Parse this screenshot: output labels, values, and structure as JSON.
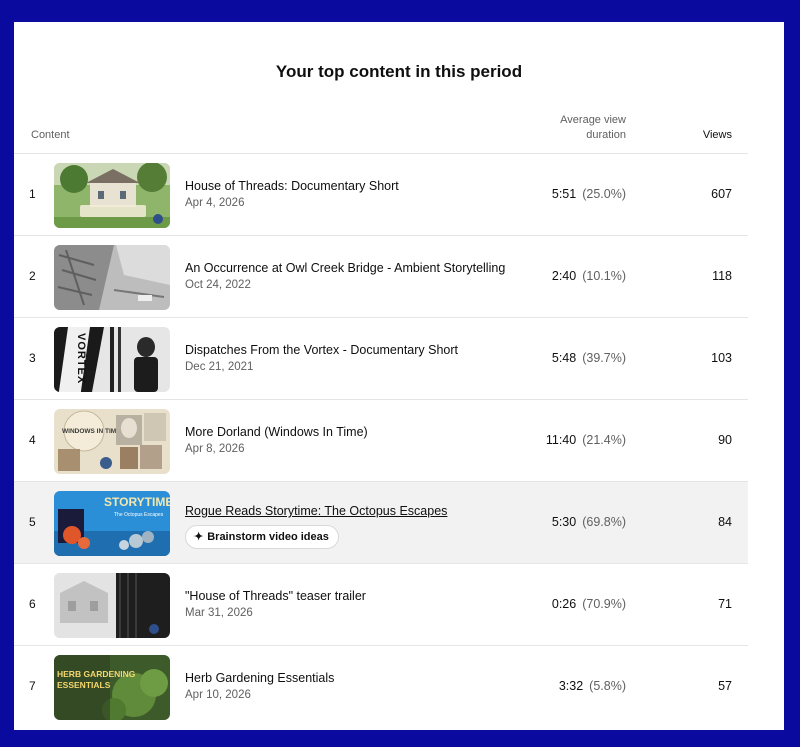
{
  "title": "Your top content in this period",
  "headers": {
    "content": "Content",
    "duration_line1": "Average view",
    "duration_line2": "duration",
    "views": "Views"
  },
  "rows": [
    {
      "rank": "1",
      "title": "House of Threads: Documentary Short",
      "date": "Apr 4, 2026",
      "duration": "5:51",
      "percent": "(25.0%)",
      "views": "607"
    },
    {
      "rank": "2",
      "title": "An Occurrence at Owl Creek Bridge - Ambient Storytelling",
      "date": "Oct 24, 2022",
      "duration": "2:40",
      "percent": "(10.1%)",
      "views": "118"
    },
    {
      "rank": "3",
      "title": "Dispatches From the Vortex - Documentary Short",
      "date": "Dec 21, 2021",
      "duration": "5:48",
      "percent": "(39.7%)",
      "views": "103",
      "thumb_text": "VORTEX"
    },
    {
      "rank": "4",
      "title": "More Dorland (Windows In Time)",
      "date": "Apr 8, 2026",
      "duration": "11:40",
      "percent": "(21.4%)",
      "views": "90",
      "thumb_text": "WINDOWS IN TIME"
    },
    {
      "rank": "5",
      "title": "Rogue Reads Storytime: The Octopus Escapes",
      "chip": "Brainstorm video ideas",
      "duration": "5:30",
      "percent": "(69.8%)",
      "views": "84",
      "thumb_text": "STORYTIME!",
      "thumb_sub": "The Octopus Escapes"
    },
    {
      "rank": "6",
      "title": "\"House of Threads\" teaser trailer",
      "date": "Mar 31, 2026",
      "duration": "0:26",
      "percent": "(70.9%)",
      "views": "71"
    },
    {
      "rank": "7",
      "title": "Herb Gardening Essentials",
      "date": "Apr 10, 2026",
      "duration": "3:32",
      "percent": "(5.8%)",
      "views": "57",
      "thumb_text_1": "HERB GARDENING",
      "thumb_text_2": "ESSENTIALS"
    }
  ],
  "colors": {
    "frame": "#0a0a9e",
    "highlight_row": "#f2f2f2",
    "muted_text": "#606060"
  },
  "icons": {
    "chip": "sparkle-icon"
  }
}
